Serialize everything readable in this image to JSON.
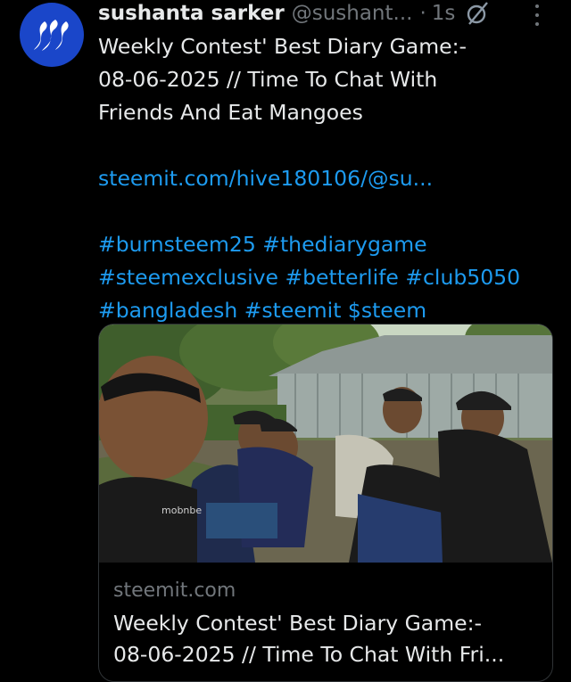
{
  "author": {
    "name": "sushanta sarker",
    "handle": "@sushant...",
    "separator": "·",
    "time": "1s"
  },
  "tweet": {
    "title_lines": [
      "Weekly Contest' Best Diary Game:-",
      "08-06-2025 // Time To Chat With",
      "Friends And Eat Mangoes"
    ],
    "link": "steemit.com/hive180106/@su...",
    "hashtag_lines": [
      "#burnsteem25 #thediarygame",
      "#steemexclusive #betterlife #club5050",
      "#bangladesh #steemit $steem"
    ]
  },
  "card": {
    "domain": "steemit.com",
    "title_lines": [
      "Weekly Contest' Best Diary Game:-",
      "08-06-2025 // Time To Chat With Fri..."
    ],
    "photo_text": "mobnbe"
  },
  "icons": {
    "avatar": "steem-logo-icon",
    "grok": "grok-icon",
    "more": "more-options-icon"
  },
  "colors": {
    "background": "#000000",
    "text": "#e7e9ea",
    "muted": "#71767b",
    "link": "#1d9bf0",
    "avatar": "#1a46c9"
  }
}
